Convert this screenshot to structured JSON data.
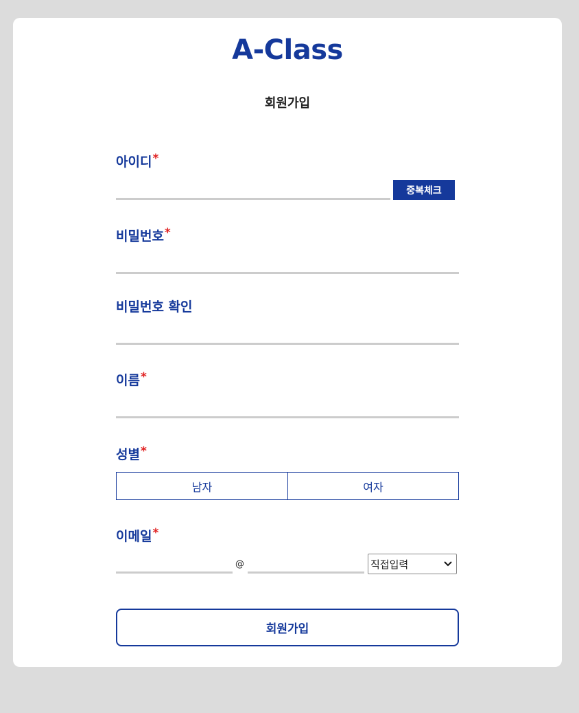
{
  "brand": {
    "logo": "A-Class"
  },
  "page": {
    "title": "회원가입"
  },
  "fields": {
    "userid": {
      "label": "아이디",
      "required_mark": "*",
      "value": "",
      "check_button": "중복체크"
    },
    "password": {
      "label": "비밀번호",
      "required_mark": "*",
      "value": ""
    },
    "password_confirm": {
      "label": "비밀번호 확인",
      "value": ""
    },
    "name": {
      "label": "이름",
      "required_mark": "*",
      "value": ""
    },
    "gender": {
      "label": "성별",
      "required_mark": "*",
      "options": [
        "남자",
        "여자"
      ]
    },
    "email": {
      "label": "이메일",
      "required_mark": "*",
      "local": "",
      "at": "@",
      "domain": "",
      "select_value": "직접입력"
    }
  },
  "submit": {
    "label": "회원가입"
  },
  "colors": {
    "accent": "#15399b",
    "required": "#e02020",
    "underline": "#cccccc",
    "background": "#dcdcdc"
  }
}
